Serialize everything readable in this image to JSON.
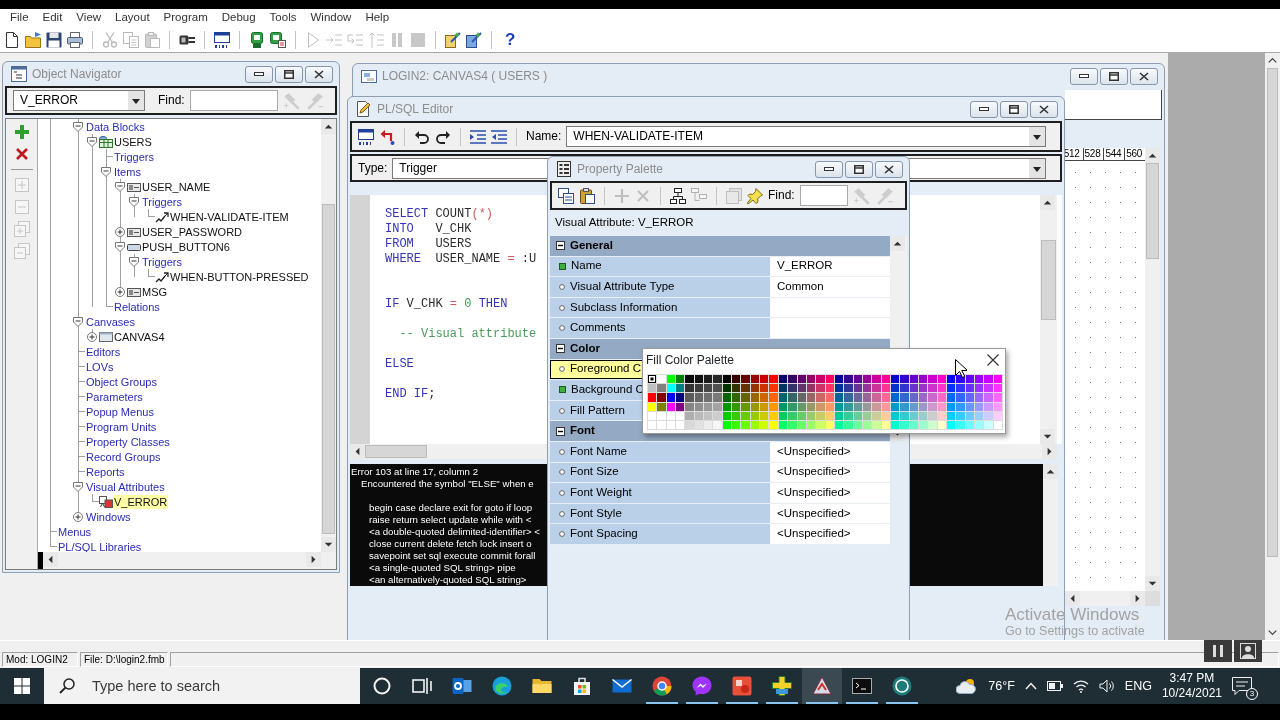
{
  "menu_bar": [
    "File",
    "Edit",
    "View",
    "Layout",
    "Program",
    "Debug",
    "Tools",
    "Window",
    "Help"
  ],
  "toolbar": [
    {
      "disabled": false
    },
    {
      "disabled": false
    },
    {
      "disabled": false
    },
    {
      "disabled": false
    },
    {
      "disabled": true
    },
    {
      "disabled": true
    },
    {
      "disabled": true
    },
    {
      "disabled": false
    },
    {
      "disabled": false
    },
    {
      "disabled": false
    },
    {
      "disabled": false
    },
    {
      "disabled": true
    },
    {
      "disabled": true
    },
    {
      "disabled": true
    },
    {
      "disabled": true
    },
    {
      "disabled": true
    },
    {
      "disabled": true
    },
    {
      "disabled": false
    },
    {
      "disabled": false
    },
    {
      "disabled": false,
      "label": "?"
    }
  ],
  "object_navigator": {
    "title": "Object Navigator",
    "active": false,
    "selector": "V_ERROR",
    "find_label": "Find:",
    "find_buttons": [
      {
        "disabled": true
      },
      {
        "disabled": true
      }
    ],
    "side_tools": [
      {
        "disabled": false
      },
      {
        "disabled": false
      },
      {
        "disabled": true
      },
      {
        "disabled": true
      },
      {
        "disabled": true
      },
      {
        "disabled": true
      }
    ],
    "tree": [
      {
        "children": [
          {
            "children": [
              {
                "label": "Data Blocks",
                "kind": "category",
                "expanded": true,
                "selected": false,
                "children": [
                  {
                    "label": "USERS",
                    "kind": "block",
                    "expanded": true,
                    "selected": false,
                    "children": [
                      {
                        "label": "Triggers",
                        "kind": "category",
                        "selected": false
                      },
                      {
                        "label": "Items",
                        "kind": "category",
                        "expanded": true,
                        "selected": false,
                        "children": [
                          {
                            "label": "USER_NAME",
                            "kind": "text-item",
                            "expanded": true,
                            "selected": false,
                            "children": [
                              {
                                "label": "Triggers",
                                "kind": "category",
                                "expanded": true,
                                "selected": false,
                                "children": [
                                  {
                                    "label": "WHEN-VALIDATE-ITEM",
                                    "kind": "trigger",
                                    "selected": false
                                  }
                                ]
                              }
                            ]
                          },
                          {
                            "label": "USER_PASSWORD",
                            "kind": "text-item",
                            "expanded": false,
                            "selected": false
                          },
                          {
                            "label": "PUSH_BUTTON6",
                            "kind": "button",
                            "expanded": true,
                            "selected": false,
                            "children": [
                              {
                                "label": "Triggers",
                                "kind": "category",
                                "expanded": true,
                                "selected": false,
                                "children": [
                                  {
                                    "label": "WHEN-BUTTON-PRESSED",
                                    "kind": "trigger",
                                    "selected": false
                                  }
                                ]
                              }
                            ]
                          },
                          {
                            "label": "MSG",
                            "kind": "text-item",
                            "expanded": false,
                            "selected": false
                          }
                        ]
                      },
                      {
                        "label": "Relations",
                        "kind": "category",
                        "selected": false
                      }
                    ]
                  }
                ]
              },
              {
                "label": "Canvases",
                "kind": "category",
                "expanded": true,
                "selected": false,
                "children": [
                  {
                    "label": "CANVAS4",
                    "kind": "canvas",
                    "expanded": false,
                    "selected": false
                  }
                ]
              },
              {
                "label": "Editors",
                "kind": "category",
                "selected": false
              },
              {
                "label": "LOVs",
                "kind": "category",
                "selected": false
              },
              {
                "label": "Object Groups",
                "kind": "category",
                "selected": false
              },
              {
                "label": "Parameters",
                "kind": "category",
                "selected": false
              },
              {
                "label": "Popup Menus",
                "kind": "category",
                "selected": false
              },
              {
                "label": "Program Units",
                "kind": "category",
                "selected": false
              },
              {
                "label": "Property Classes",
                "kind": "category",
                "selected": false
              },
              {
                "label": "Record Groups",
                "kind": "category",
                "selected": false
              },
              {
                "label": "Reports",
                "kind": "category",
                "selected": false
              },
              {
                "label": "Visual Attributes",
                "kind": "category",
                "expanded": true,
                "selected": false,
                "children": [
                  {
                    "label": "V_ERROR",
                    "kind": "visual-attribute",
                    "selected": true
                  }
                ]
              },
              {
                "label": "Windows",
                "kind": "category",
                "expanded": false,
                "selected": false
              }
            ]
          }
        ]
      },
      {
        "label": "Menus",
        "kind": "category",
        "selected": false
      },
      {
        "label": "PL/SQL Libraries",
        "kind": "category",
        "selected": false
      }
    ]
  },
  "layout_editor": {
    "title": "LOGIN2: CANVAS4 ( USERS )",
    "active": false,
    "ruler_marks": [
      "512",
      "528",
      "544",
      "560"
    ]
  },
  "plsql_editor": {
    "title": "PL/SQL Editor",
    "active": false,
    "name_label": "Name:",
    "name_value": "WHEN-VALIDATE-ITEM",
    "type_label": "Type:",
    "type_value": "Trigger",
    "code_lines": [
      {
        "kind": "code",
        "tokens": [
          {
            "text": "SELECT",
            "kind": "keyword"
          },
          {
            "text": " COUNT",
            "kind": "plain"
          },
          {
            "text": "(*)",
            "kind": "operator"
          }
        ]
      },
      {
        "kind": "code",
        "tokens": [
          {
            "text": "INTO",
            "kind": "keyword"
          },
          {
            "text": "   V_CHK",
            "kind": "plain"
          }
        ]
      },
      {
        "kind": "code",
        "tokens": [
          {
            "text": "FROM",
            "kind": "keyword"
          },
          {
            "text": "   USERS",
            "kind": "plain"
          }
        ]
      },
      {
        "kind": "code",
        "tokens": [
          {
            "text": "WHERE",
            "kind": "keyword"
          },
          {
            "text": "  USER_NAME ",
            "kind": "plain"
          },
          {
            "text": "=",
            "kind": "operator"
          },
          {
            "text": " :U",
            "kind": "plain"
          }
        ]
      },
      {
        "kind": "blank"
      },
      {
        "kind": "blank"
      },
      {
        "kind": "code",
        "tokens": [
          {
            "text": "IF",
            "kind": "keyword"
          },
          {
            "text": " V_CHK ",
            "kind": "plain"
          },
          {
            "text": "=",
            "kind": "operator"
          },
          {
            "text": " 0",
            "kind": "number"
          },
          {
            "text": " THEN",
            "kind": "keyword"
          }
        ]
      },
      {
        "kind": "blank"
      },
      {
        "kind": "code",
        "tokens": [
          {
            "text": "  -- Visual attribute",
            "kind": "comment"
          }
        ]
      },
      {
        "kind": "blank"
      },
      {
        "kind": "code",
        "tokens": [
          {
            "text": "ELSE",
            "kind": "keyword"
          }
        ]
      },
      {
        "kind": "blank"
      },
      {
        "kind": "code",
        "tokens": [
          {
            "text": "END IF",
            "kind": "keyword"
          },
          {
            "text": ";",
            "kind": "plain"
          }
        ]
      }
    ],
    "messages": [
      {
        "kind": "heading",
        "text": "Error 103 at line 17, column 2"
      },
      {
        "kind": "detail",
        "text": "Encountered the symbol \"ELSE\" when e"
      },
      {
        "kind": "blank"
      },
      {
        "kind": "list",
        "text": "begin case declare exit for goto if loop"
      },
      {
        "kind": "list",
        "text": "raise return select update while with <"
      },
      {
        "kind": "list",
        "text": "<a double-quoted delimited-identifier> <"
      },
      {
        "kind": "list",
        "text": "close current delete fetch lock insert o"
      },
      {
        "kind": "list",
        "text": "savepoint set sql execute commit forall"
      },
      {
        "kind": "list",
        "text": "<a single-quoted SQL string> pipe"
      },
      {
        "kind": "list",
        "text": "<an alternatively-quoted SQL string>"
      }
    ]
  },
  "property_palette": {
    "title": "Property Palette",
    "active": false,
    "toolbar": [
      {
        "disabled": false
      },
      {
        "disabled": false
      },
      {
        "disabled": true
      },
      {
        "disabled": true
      },
      {
        "disabled": false
      },
      {
        "disabled": true
      },
      {
        "disabled": true
      },
      {
        "disabled": false
      }
    ],
    "find_label": "Find:",
    "find_buttons": [
      {
        "disabled": true
      },
      {
        "disabled": true
      }
    ],
    "context": "Visual Attribute: V_ERROR",
    "rows": [
      {
        "kind": "group",
        "label": "General",
        "expanded": true
      },
      {
        "kind": "property",
        "label": "Name",
        "value": "V_ERROR",
        "modified": true,
        "selected": false
      },
      {
        "kind": "property",
        "label": "Visual Attribute Type",
        "value": "Common",
        "modified": false,
        "selected": false
      },
      {
        "kind": "property",
        "label": "Subclass Information",
        "modified": false,
        "selected": false
      },
      {
        "kind": "property",
        "label": "Comments",
        "modified": false,
        "selected": false
      },
      {
        "kind": "group",
        "label": "Color",
        "expanded": true
      },
      {
        "kind": "property",
        "label": "Foreground C",
        "modified": false,
        "selected": true
      },
      {
        "kind": "property",
        "label": "Background C",
        "modified": true,
        "selected": false
      },
      {
        "kind": "property",
        "label": "Fill Pattern",
        "modified": false,
        "selected": false
      },
      {
        "kind": "group",
        "label": "Font",
        "expanded": true
      },
      {
        "kind": "property",
        "label": "Font Name",
        "value": "<Unspecified>",
        "modified": false,
        "selected": false
      },
      {
        "kind": "property",
        "label": "Font Size",
        "value": "<Unspecified>",
        "modified": false,
        "selected": false
      },
      {
        "kind": "property",
        "label": "Font Weight",
        "value": "<Unspecified>",
        "modified": false,
        "selected": false
      },
      {
        "kind": "property",
        "label": "Font Style",
        "value": "<Unspecified>",
        "modified": false,
        "selected": false
      },
      {
        "kind": "property",
        "label": "Font Spacing",
        "value": "<Unspecified>",
        "modified": false,
        "selected": false
      }
    ]
  },
  "color_palette": {
    "title": "Fill Color Palette",
    "active": true,
    "swatch_rows": [
      [
        {
          "color": "#000000",
          "selected": true
        },
        {
          "color": "#ffffff",
          "selected": false
        },
        {
          "color": "#00ff00",
          "selected": false
        },
        {
          "color": "#008000",
          "selected": false
        },
        {
          "color": "#080808",
          "selected": false
        },
        {
          "color": "#121212",
          "selected": false
        },
        {
          "color": "#1d1d1d",
          "selected": false
        },
        {
          "color": "#272727",
          "selected": false
        },
        {
          "color": "#000000",
          "selected": false
        },
        {
          "color": "#330000",
          "selected": false
        },
        {
          "color": "#660000",
          "selected": false
        },
        {
          "color": "#990000",
          "selected": false
        },
        {
          "color": "#cc0000",
          "selected": false
        },
        {
          "color": "#ff0000",
          "selected": false
        },
        {
          "color": "#000066",
          "selected": false
        },
        {
          "color": "#330066",
          "selected": false
        },
        {
          "color": "#660066",
          "selected": false
        },
        {
          "color": "#990066",
          "selected": false
        },
        {
          "color": "#cc0066",
          "selected": false
        },
        {
          "color": "#ff0066",
          "selected": false
        },
        {
          "color": "#000099",
          "selected": false
        },
        {
          "color": "#330099",
          "selected": false
        },
        {
          "color": "#660099",
          "selected": false
        },
        {
          "color": "#990099",
          "selected": false
        },
        {
          "color": "#cc0099",
          "selected": false
        },
        {
          "color": "#ff0099",
          "selected": false
        },
        {
          "color": "#0000cc",
          "selected": false
        },
        {
          "color": "#3300cc",
          "selected": false
        },
        {
          "color": "#6600cc",
          "selected": false
        },
        {
          "color": "#9900cc",
          "selected": false
        },
        {
          "color": "#cc00cc",
          "selected": false
        },
        {
          "color": "#ff00cc",
          "selected": false
        },
        {
          "color": "#0000ff",
          "selected": false
        },
        {
          "color": "#3300ff",
          "selected": false
        },
        {
          "color": "#6600ff",
          "selected": false
        },
        {
          "color": "#9900ff",
          "selected": false
        },
        {
          "color": "#cc00ff",
          "selected": false
        },
        {
          "color": "#ff00ff",
          "selected": false
        }
      ],
      [
        {
          "color": "#c0c0c0",
          "selected": false
        },
        {
          "color": "#808080",
          "selected": false
        },
        {
          "color": "#00ffff",
          "selected": false
        },
        {
          "color": "#008080",
          "selected": false
        },
        {
          "color": "#323232",
          "selected": false
        },
        {
          "color": "#3c3c3c",
          "selected": false
        },
        {
          "color": "#474747",
          "selected": false
        },
        {
          "color": "#515151",
          "selected": false
        },
        {
          "color": "#003300",
          "selected": false
        },
        {
          "color": "#333300",
          "selected": false
        },
        {
          "color": "#663300",
          "selected": false
        },
        {
          "color": "#993300",
          "selected": false
        },
        {
          "color": "#cc3300",
          "selected": false
        },
        {
          "color": "#ff3300",
          "selected": false
        },
        {
          "color": "#003366",
          "selected": false
        },
        {
          "color": "#333366",
          "selected": false
        },
        {
          "color": "#663366",
          "selected": false
        },
        {
          "color": "#993366",
          "selected": false
        },
        {
          "color": "#cc3366",
          "selected": false
        },
        {
          "color": "#ff3366",
          "selected": false
        },
        {
          "color": "#003399",
          "selected": false
        },
        {
          "color": "#333399",
          "selected": false
        },
        {
          "color": "#663399",
          "selected": false
        },
        {
          "color": "#993399",
          "selected": false
        },
        {
          "color": "#cc3399",
          "selected": false
        },
        {
          "color": "#ff3399",
          "selected": false
        },
        {
          "color": "#0033cc",
          "selected": false
        },
        {
          "color": "#3333cc",
          "selected": false
        },
        {
          "color": "#6633cc",
          "selected": false
        },
        {
          "color": "#9933cc",
          "selected": false
        },
        {
          "color": "#cc33cc",
          "selected": false
        },
        {
          "color": "#ff33cc",
          "selected": false
        },
        {
          "color": "#0033ff",
          "selected": false
        },
        {
          "color": "#3333ff",
          "selected": false
        },
        {
          "color": "#6633ff",
          "selected": false
        },
        {
          "color": "#9933ff",
          "selected": false
        },
        {
          "color": "#cc33ff",
          "selected": false
        },
        {
          "color": "#ff33ff",
          "selected": false
        }
      ],
      [
        {
          "color": "#ff0000",
          "selected": false
        },
        {
          "color": "#800000",
          "selected": false
        },
        {
          "color": "#0000ff",
          "selected": false
        },
        {
          "color": "#000080",
          "selected": false
        },
        {
          "color": "#5b5b5b",
          "selected": false
        },
        {
          "color": "#666666",
          "selected": false
        },
        {
          "color": "#707070",
          "selected": false
        },
        {
          "color": "#7a7a7a",
          "selected": false
        },
        {
          "color": "#006600",
          "selected": false
        },
        {
          "color": "#336600",
          "selected": false
        },
        {
          "color": "#666600",
          "selected": false
        },
        {
          "color": "#996600",
          "selected": false
        },
        {
          "color": "#cc6600",
          "selected": false
        },
        {
          "color": "#ff6600",
          "selected": false
        },
        {
          "color": "#006666",
          "selected": false
        },
        {
          "color": "#336666",
          "selected": false
        },
        {
          "color": "#666666",
          "selected": false
        },
        {
          "color": "#996666",
          "selected": false
        },
        {
          "color": "#cc6666",
          "selected": false
        },
        {
          "color": "#ff6666",
          "selected": false
        },
        {
          "color": "#006699",
          "selected": false
        },
        {
          "color": "#336699",
          "selected": false
        },
        {
          "color": "#666699",
          "selected": false
        },
        {
          "color": "#996699",
          "selected": false
        },
        {
          "color": "#cc6699",
          "selected": false
        },
        {
          "color": "#ff6699",
          "selected": false
        },
        {
          "color": "#0066cc",
          "selected": false
        },
        {
          "color": "#3366cc",
          "selected": false
        },
        {
          "color": "#6666cc",
          "selected": false
        },
        {
          "color": "#9966cc",
          "selected": false
        },
        {
          "color": "#cc66cc",
          "selected": false
        },
        {
          "color": "#ff66cc",
          "selected": false
        },
        {
          "color": "#0066ff",
          "selected": false
        },
        {
          "color": "#3366ff",
          "selected": false
        },
        {
          "color": "#6666ff",
          "selected": false
        },
        {
          "color": "#9966ff",
          "selected": false
        },
        {
          "color": "#cc66ff",
          "selected": false
        },
        {
          "color": "#ff66ff",
          "selected": false
        }
      ],
      [
        {
          "color": "#ffff00",
          "selected": false
        },
        {
          "color": "#808000",
          "selected": false
        },
        {
          "color": "#ff00ff",
          "selected": false
        },
        {
          "color": "#800080",
          "selected": false
        },
        {
          "color": "#858585",
          "selected": false
        },
        {
          "color": "#8f8f8f",
          "selected": false
        },
        {
          "color": "#9a9a9a",
          "selected": false
        },
        {
          "color": "#a4a4a4",
          "selected": false
        },
        {
          "color": "#009900",
          "selected": false
        },
        {
          "color": "#339900",
          "selected": false
        },
        {
          "color": "#669900",
          "selected": false
        },
        {
          "color": "#999900",
          "selected": false
        },
        {
          "color": "#cc9900",
          "selected": false
        },
        {
          "color": "#ff9900",
          "selected": false
        },
        {
          "color": "#009966",
          "selected": false
        },
        {
          "color": "#339966",
          "selected": false
        },
        {
          "color": "#669966",
          "selected": false
        },
        {
          "color": "#999966",
          "selected": false
        },
        {
          "color": "#cc9966",
          "selected": false
        },
        {
          "color": "#ff9966",
          "selected": false
        },
        {
          "color": "#009999",
          "selected": false
        },
        {
          "color": "#339999",
          "selected": false
        },
        {
          "color": "#669999",
          "selected": false
        },
        {
          "color": "#999999",
          "selected": false
        },
        {
          "color": "#cc9999",
          "selected": false
        },
        {
          "color": "#ff9999",
          "selected": false
        },
        {
          "color": "#0099cc",
          "selected": false
        },
        {
          "color": "#3399cc",
          "selected": false
        },
        {
          "color": "#6699cc",
          "selected": false
        },
        {
          "color": "#9999cc",
          "selected": false
        },
        {
          "color": "#cc99cc",
          "selected": false
        },
        {
          "color": "#ff99cc",
          "selected": false
        },
        {
          "color": "#0099ff",
          "selected": false
        },
        {
          "color": "#3399ff",
          "selected": false
        },
        {
          "color": "#6699ff",
          "selected": false
        },
        {
          "color": "#9999ff",
          "selected": false
        },
        {
          "color": "#cc99ff",
          "selected": false
        },
        {
          "color": "#ff99ff",
          "selected": false
        }
      ],
      [
        {
          "color": "#ffffff",
          "selected": false
        },
        {
          "color": "#ffffff",
          "selected": false
        },
        {
          "color": "#ffffff",
          "selected": false
        },
        {
          "color": "#ffffff",
          "selected": false
        },
        {
          "color": "#aeaeae",
          "selected": false
        },
        {
          "color": "#b9b9b9",
          "selected": false
        },
        {
          "color": "#c3c3c3",
          "selected": false
        },
        {
          "color": "#cecece",
          "selected": false
        },
        {
          "color": "#00cc00",
          "selected": false
        },
        {
          "color": "#33cc00",
          "selected": false
        },
        {
          "color": "#66cc00",
          "selected": false
        },
        {
          "color": "#99cc00",
          "selected": false
        },
        {
          "color": "#cccc00",
          "selected": false
        },
        {
          "color": "#ffcc00",
          "selected": false
        },
        {
          "color": "#00cc66",
          "selected": false
        },
        {
          "color": "#33cc66",
          "selected": false
        },
        {
          "color": "#66cc66",
          "selected": false
        },
        {
          "color": "#99cc66",
          "selected": false
        },
        {
          "color": "#cccc66",
          "selected": false
        },
        {
          "color": "#ffcc66",
          "selected": false
        },
        {
          "color": "#00cc99",
          "selected": false
        },
        {
          "color": "#33cc99",
          "selected": false
        },
        {
          "color": "#66cc99",
          "selected": false
        },
        {
          "color": "#99cc99",
          "selected": false
        },
        {
          "color": "#cccc99",
          "selected": false
        },
        {
          "color": "#ffcc99",
          "selected": false
        },
        {
          "color": "#00cccc",
          "selected": false
        },
        {
          "color": "#33cccc",
          "selected": false
        },
        {
          "color": "#66cccc",
          "selected": false
        },
        {
          "color": "#99cccc",
          "selected": false
        },
        {
          "color": "#cccccc",
          "selected": false
        },
        {
          "color": "#ffcccc",
          "selected": false
        },
        {
          "color": "#00ccff",
          "selected": false
        },
        {
          "color": "#33ccff",
          "selected": false
        },
        {
          "color": "#66ccff",
          "selected": false
        },
        {
          "color": "#99ccff",
          "selected": false
        },
        {
          "color": "#ccccff",
          "selected": false
        },
        {
          "color": "#ffccff",
          "selected": false
        }
      ],
      [
        {
          "color": "#ffffff",
          "selected": false
        },
        {
          "color": "#ffffff",
          "selected": false
        },
        {
          "color": "#ffffff",
          "selected": false
        },
        {
          "color": "#ffffff",
          "selected": false
        },
        {
          "color": "#d8d8d8",
          "selected": false
        },
        {
          "color": "#e2e2e2",
          "selected": false
        },
        {
          "color": "#ededed",
          "selected": false
        },
        {
          "color": "#f7f7f7",
          "selected": false
        },
        {
          "color": "#00ff00",
          "selected": false
        },
        {
          "color": "#33ff00",
          "selected": false
        },
        {
          "color": "#66ff00",
          "selected": false
        },
        {
          "color": "#99ff00",
          "selected": false
        },
        {
          "color": "#ccff00",
          "selected": false
        },
        {
          "color": "#ffff00",
          "selected": false
        },
        {
          "color": "#00ff66",
          "selected": false
        },
        {
          "color": "#33ff66",
          "selected": false
        },
        {
          "color": "#66ff66",
          "selected": false
        },
        {
          "color": "#99ff66",
          "selected": false
        },
        {
          "color": "#ccff66",
          "selected": false
        },
        {
          "color": "#ffff66",
          "selected": false
        },
        {
          "color": "#00ff99",
          "selected": false
        },
        {
          "color": "#33ff99",
          "selected": false
        },
        {
          "color": "#66ff99",
          "selected": false
        },
        {
          "color": "#99ff99",
          "selected": false
        },
        {
          "color": "#ccff99",
          "selected": false
        },
        {
          "color": "#ffff99",
          "selected": false
        },
        {
          "color": "#00ffcc",
          "selected": false
        },
        {
          "color": "#33ffcc",
          "selected": false
        },
        {
          "color": "#66ffcc",
          "selected": false
        },
        {
          "color": "#99ffcc",
          "selected": false
        },
        {
          "color": "#ccffcc",
          "selected": false
        },
        {
          "color": "#ffffcc",
          "selected": false
        },
        {
          "color": "#00ffff",
          "selected": false
        },
        {
          "color": "#33ffff",
          "selected": false
        },
        {
          "color": "#66ffff",
          "selected": false
        },
        {
          "color": "#99ffff",
          "selected": false
        },
        {
          "color": "#ccffff",
          "selected": false
        },
        {
          "color": "#ffffff",
          "selected": false
        }
      ]
    ]
  },
  "activation_notice": {
    "title": "Activate Windows",
    "detail": "Go to Settings to activate"
  },
  "status_bar": [
    "Mod: LOGIN2",
    "File: D:\\login2.fmb"
  ],
  "taskbar": {
    "search": {
      "placeholder": "Type here to search"
    },
    "buttons": [
      {
        "running": false,
        "active": false
      },
      {
        "running": false,
        "active": false
      },
      {
        "running": false,
        "active": false
      },
      {
        "running": false,
        "active": false
      },
      {
        "running": false,
        "active": false
      },
      {
        "running": false,
        "active": false
      },
      {
        "running": false,
        "active": false
      },
      {
        "running": true,
        "active": false
      },
      {
        "running": true,
        "active": false
      },
      {
        "running": true,
        "active": false
      },
      {
        "running": true,
        "active": false
      },
      {
        "running": true,
        "active": true
      },
      {
        "running": true,
        "active": false
      },
      {
        "running": true,
        "active": false
      }
    ],
    "weather": "76°F",
    "language": "ENG",
    "time": "3:47 PM",
    "date": "10/24/2021",
    "notification_count": "3"
  }
}
